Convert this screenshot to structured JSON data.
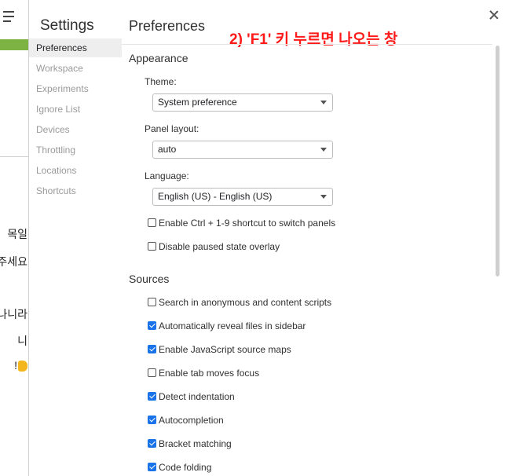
{
  "left_strip": {
    "lines": [
      "목일",
      "주세요",
      "나니라",
      "니",
      "!"
    ]
  },
  "sidebar": {
    "title": "Settings",
    "items": [
      {
        "label": "Preferences",
        "active": true
      },
      {
        "label": "Workspace"
      },
      {
        "label": "Experiments"
      },
      {
        "label": "Ignore List"
      },
      {
        "label": "Devices"
      },
      {
        "label": "Throttling"
      },
      {
        "label": "Locations"
      },
      {
        "label": "Shortcuts"
      }
    ]
  },
  "main": {
    "title": "Preferences",
    "annotation": "2) 'F1' 키 누르면 나오는 창",
    "appearance": {
      "heading": "Appearance",
      "theme_label": "Theme:",
      "theme_value": "System preference",
      "panel_layout_label": "Panel layout:",
      "panel_layout_value": "auto",
      "language_label": "Language:",
      "language_value": "English (US) - English (US)",
      "options": [
        {
          "label": "Enable Ctrl + 1-9 shortcut to switch panels",
          "checked": false
        },
        {
          "label": "Disable paused state overlay",
          "checked": false
        }
      ]
    },
    "sources": {
      "heading": "Sources",
      "options": [
        {
          "label": "Search in anonymous and content scripts",
          "checked": false
        },
        {
          "label": "Automatically reveal files in sidebar",
          "checked": true
        },
        {
          "label": "Enable JavaScript source maps",
          "checked": true
        },
        {
          "label": "Enable tab moves focus",
          "checked": false
        },
        {
          "label": "Detect indentation",
          "checked": true
        },
        {
          "label": "Autocompletion",
          "checked": true
        },
        {
          "label": "Bracket matching",
          "checked": true
        },
        {
          "label": "Code folding",
          "checked": true
        }
      ]
    }
  },
  "colors": {
    "accent": "#1a73e8",
    "annotation": "#ff1a1a",
    "green_bar": "#7cb342"
  }
}
